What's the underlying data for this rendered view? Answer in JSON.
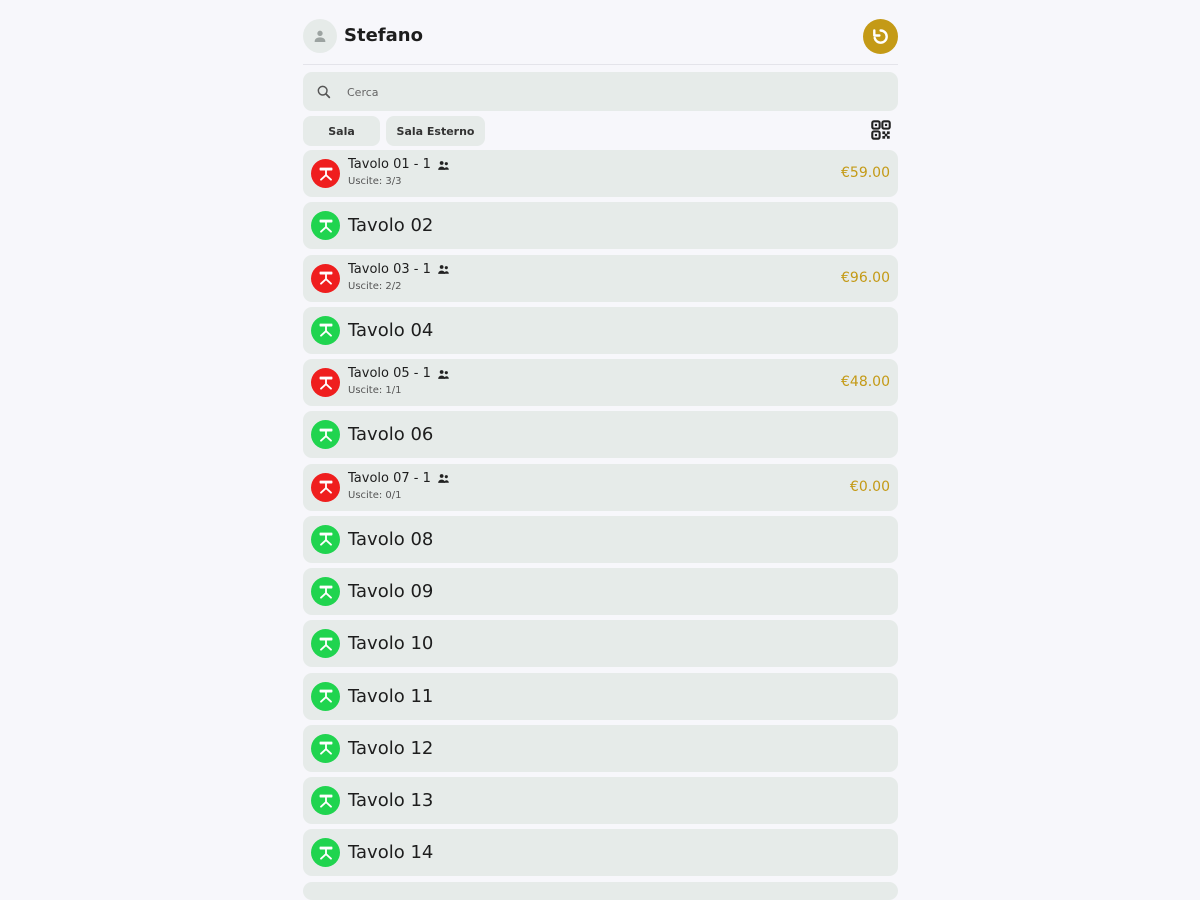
{
  "header": {
    "user_name": "Stefano",
    "avatar_icon": "user-icon",
    "refresh_icon": "refresh-icon"
  },
  "search": {
    "value": "",
    "placeholder": "Cerca",
    "icon": "search-icon"
  },
  "rooms": [
    {
      "label": "Sala"
    },
    {
      "label": "Sala Esterno"
    }
  ],
  "qr_icon": "qr-code-icon",
  "colors": {
    "accent": "#c49a16",
    "occupied": "#ef1e1e",
    "free": "#20d44f",
    "row_background": "#e6ebe9",
    "page_background": "#f7f7fb"
  },
  "tables": [
    {
      "name": "Tavolo 01",
      "status": "occupied",
      "title": "Tavolo 01 - 1",
      "courses": "Uscite: 3/3",
      "amount": "€59.00",
      "icon": "table-icon"
    },
    {
      "name": "Tavolo 02",
      "status": "free",
      "icon": "table-icon"
    },
    {
      "name": "Tavolo 03",
      "status": "occupied",
      "title": "Tavolo 03 - 1",
      "courses": "Uscite: 2/2",
      "amount": "€96.00",
      "icon": "table-icon"
    },
    {
      "name": "Tavolo 04",
      "status": "free",
      "icon": "table-icon"
    },
    {
      "name": "Tavolo 05",
      "status": "occupied",
      "title": "Tavolo 05 - 1",
      "courses": "Uscite: 1/1",
      "amount": "€48.00",
      "icon": "table-icon"
    },
    {
      "name": "Tavolo 06",
      "status": "free",
      "icon": "table-icon"
    },
    {
      "name": "Tavolo 07",
      "status": "occupied",
      "title": "Tavolo 07 - 1",
      "courses": "Uscite: 0/1",
      "amount": "€0.00",
      "icon": "table-icon"
    },
    {
      "name": "Tavolo 08",
      "status": "free",
      "icon": "table-icon"
    },
    {
      "name": "Tavolo 09",
      "status": "free",
      "icon": "table-icon"
    },
    {
      "name": "Tavolo 10",
      "status": "free",
      "icon": "table-icon"
    },
    {
      "name": "Tavolo 11",
      "status": "free",
      "icon": "table-icon"
    },
    {
      "name": "Tavolo 12",
      "status": "free",
      "icon": "table-icon"
    },
    {
      "name": "Tavolo 13",
      "status": "free",
      "icon": "table-icon"
    },
    {
      "name": "Tavolo 14",
      "status": "free",
      "icon": "table-icon"
    }
  ]
}
